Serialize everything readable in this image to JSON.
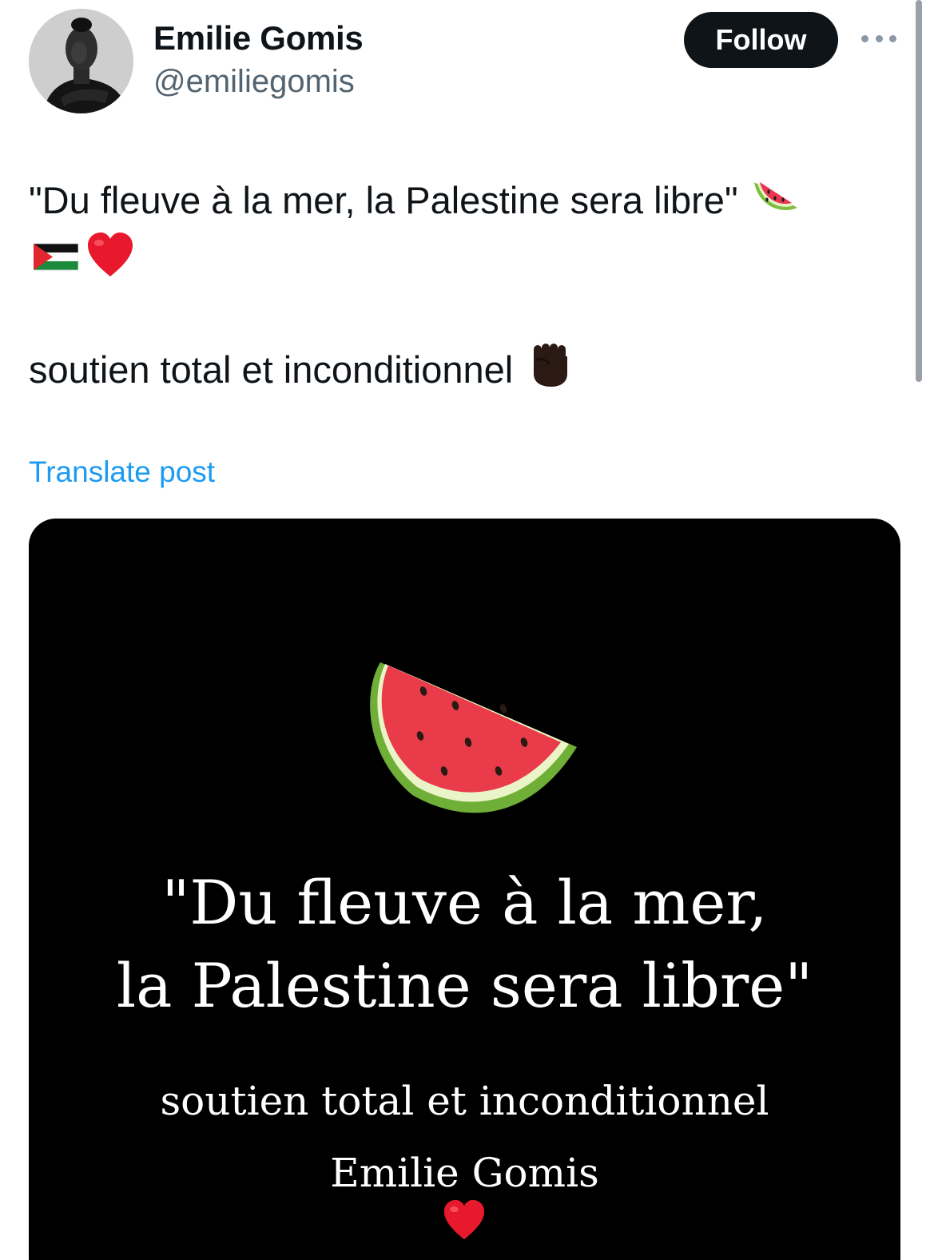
{
  "author": {
    "display_name": "Emilie Gomis",
    "handle": "@emiliegomis"
  },
  "actions": {
    "follow_label": "Follow",
    "more_icon": "more-horizontal-icon"
  },
  "post": {
    "line1_text": "\"Du fleuve à la mer, la Palestine sera libre\"",
    "line1_emoji": "watermelon-emoji",
    "line2_emojis": [
      "palestine-flag-emoji",
      "red-heart-emoji"
    ],
    "line3_text": "soutien total et inconditionnel",
    "line3_emoji": "raised-fist-emoji",
    "translate_label": "Translate post"
  },
  "media": {
    "quote_line1": "\"Du fleuve à la mer,",
    "quote_line2": "la Palestine sera libre\"",
    "support_text": "soutien total et inconditionnel",
    "author_text": "Emilie Gomis",
    "emojis": [
      "watermelon-emoji",
      "red-heart-emoji"
    ]
  },
  "colors": {
    "text_primary": "#0f1419",
    "text_secondary": "#536471",
    "link": "#1d9bf0",
    "follow_bg": "#0f1419",
    "media_bg": "#000000"
  }
}
